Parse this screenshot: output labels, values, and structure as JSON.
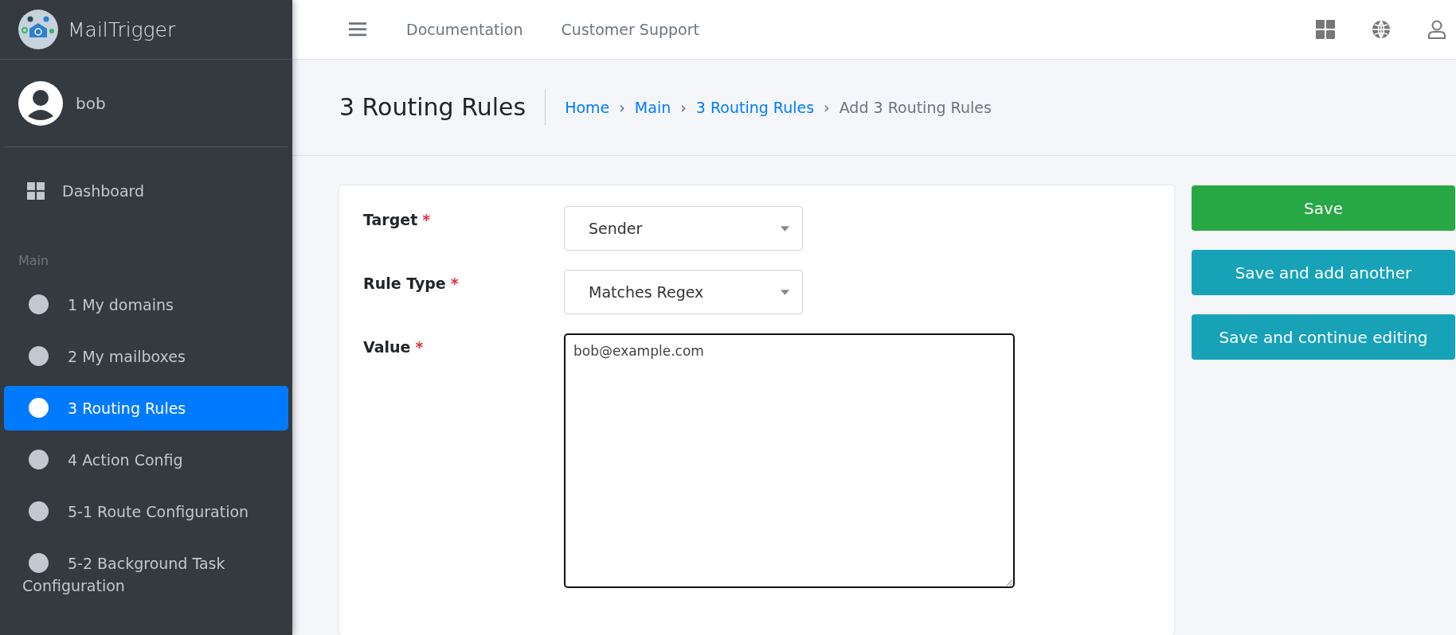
{
  "brand": {
    "name": "MailTrigger"
  },
  "user": {
    "name": "bob"
  },
  "topbar": {
    "links": [
      "Documentation",
      "Customer Support"
    ]
  },
  "sidebar": {
    "dashboard": "Dashboard",
    "section": "Main",
    "items": [
      {
        "label": "1 My domains",
        "selected": false
      },
      {
        "label": "2 My mailboxes",
        "selected": false
      },
      {
        "label": "3 Routing Rules",
        "selected": true
      },
      {
        "label": "4 Action Config",
        "selected": false
      },
      {
        "label": "5-1 Route Configuration",
        "selected": false
      },
      {
        "label": "5-2 Background Task Configuration",
        "selected": false
      }
    ]
  },
  "page_title": "3 Routing Rules",
  "breadcrumb": [
    {
      "label": "Home",
      "kind": "link"
    },
    {
      "label": "›",
      "kind": "separator"
    },
    {
      "label": "Main",
      "kind": "link"
    },
    {
      "label": "›",
      "kind": "separator"
    },
    {
      "label": "3 Routing Rules",
      "kind": "link"
    },
    {
      "label": "›",
      "kind": "separator"
    },
    {
      "label": "Add 3 Routing Rules",
      "kind": "current"
    }
  ],
  "form": {
    "fields": [
      {
        "label": "Target",
        "required_mark": "*",
        "kind": "select",
        "value": "Sender"
      },
      {
        "label": "Rule Type",
        "required_mark": "*",
        "kind": "select",
        "value": "Matches Regex"
      },
      {
        "label": "Value",
        "required_mark": "*",
        "kind": "textarea",
        "value": "bob@example.com"
      }
    ]
  },
  "actions": [
    {
      "label": "Save",
      "kind": "primary"
    },
    {
      "label": "Save and add another",
      "kind": "secondary"
    },
    {
      "label": "Save and continue editing",
      "kind": "secondary"
    }
  ]
}
